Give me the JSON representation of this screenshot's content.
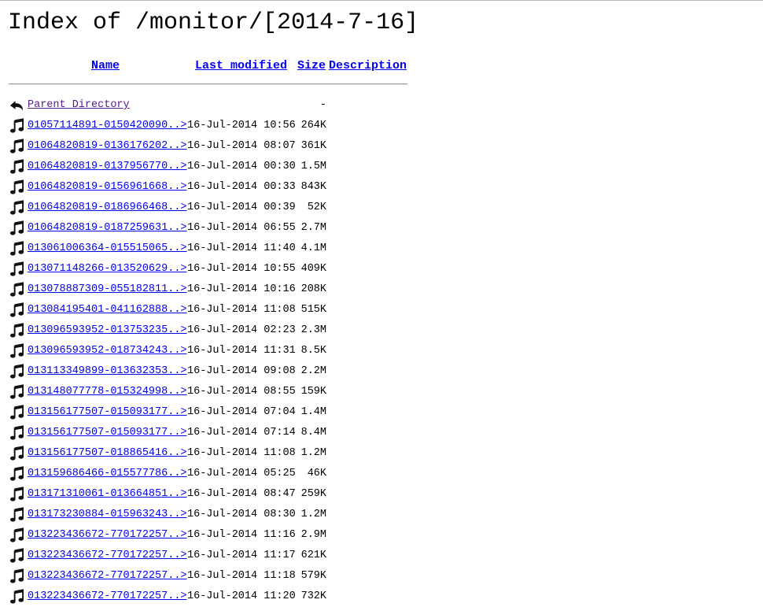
{
  "title": "Index of /monitor/[2014-7-16]",
  "columns": {
    "name": "Name",
    "last_modified": "Last modified",
    "size": "Size",
    "description": "Description"
  },
  "parent": {
    "label": "Parent Directory",
    "size": "-",
    "icon": "back-arrow-icon"
  },
  "file_icon": "music-note-icon",
  "files": [
    {
      "name": "01057114891-0150420090..>",
      "date": "16-Jul-2014 10:56",
      "size": "264K"
    },
    {
      "name": "01064820819-0136176202..>",
      "date": "16-Jul-2014 08:07",
      "size": "361K"
    },
    {
      "name": "01064820819-0137956770..>",
      "date": "16-Jul-2014 00:30",
      "size": "1.5M"
    },
    {
      "name": "01064820819-0156961668..>",
      "date": "16-Jul-2014 00:33",
      "size": "843K"
    },
    {
      "name": "01064820819-0186966468..>",
      "date": "16-Jul-2014 00:39",
      "size": "52K"
    },
    {
      "name": "01064820819-0187259631..>",
      "date": "16-Jul-2014 06:55",
      "size": "2.7M"
    },
    {
      "name": "013061006364-015515065..>",
      "date": "16-Jul-2014 11:40",
      "size": "4.1M"
    },
    {
      "name": "013071148266-013520629..>",
      "date": "16-Jul-2014 10:55",
      "size": "409K"
    },
    {
      "name": "013078887309-055182811..>",
      "date": "16-Jul-2014 10:16",
      "size": "208K"
    },
    {
      "name": "013084195401-041162888..>",
      "date": "16-Jul-2014 11:08",
      "size": "515K"
    },
    {
      "name": "013096593952-013753235..>",
      "date": "16-Jul-2014 02:23",
      "size": "2.3M"
    },
    {
      "name": "013096593952-018734243..>",
      "date": "16-Jul-2014 11:31",
      "size": "8.5K"
    },
    {
      "name": "013113349899-013632353..>",
      "date": "16-Jul-2014 09:08",
      "size": "2.2M"
    },
    {
      "name": "013148077778-015324998..>",
      "date": "16-Jul-2014 08:55",
      "size": "159K"
    },
    {
      "name": "013156177507-015093177..>",
      "date": "16-Jul-2014 07:04",
      "size": "1.4M"
    },
    {
      "name": "013156177507-015093177..>",
      "date": "16-Jul-2014 07:14",
      "size": "8.4M"
    },
    {
      "name": "013156177507-018865416..>",
      "date": "16-Jul-2014 11:08",
      "size": "1.2M"
    },
    {
      "name": "013159686466-015577786..>",
      "date": "16-Jul-2014 05:25",
      "size": "46K"
    },
    {
      "name": "013171310061-013664851..>",
      "date": "16-Jul-2014 08:47",
      "size": "259K"
    },
    {
      "name": "013173230884-015963243..>",
      "date": "16-Jul-2014 08:30",
      "size": "1.2M"
    },
    {
      "name": "013223436672-770172257..>",
      "date": "16-Jul-2014 11:16",
      "size": "2.9M"
    },
    {
      "name": "013223436672-770172257..>",
      "date": "16-Jul-2014 11:17",
      "size": "621K"
    },
    {
      "name": "013223436672-770172257..>",
      "date": "16-Jul-2014 11:18",
      "size": "579K"
    },
    {
      "name": "013223436672-770172257..>",
      "date": "16-Jul-2014 11:20",
      "size": "732K"
    }
  ]
}
